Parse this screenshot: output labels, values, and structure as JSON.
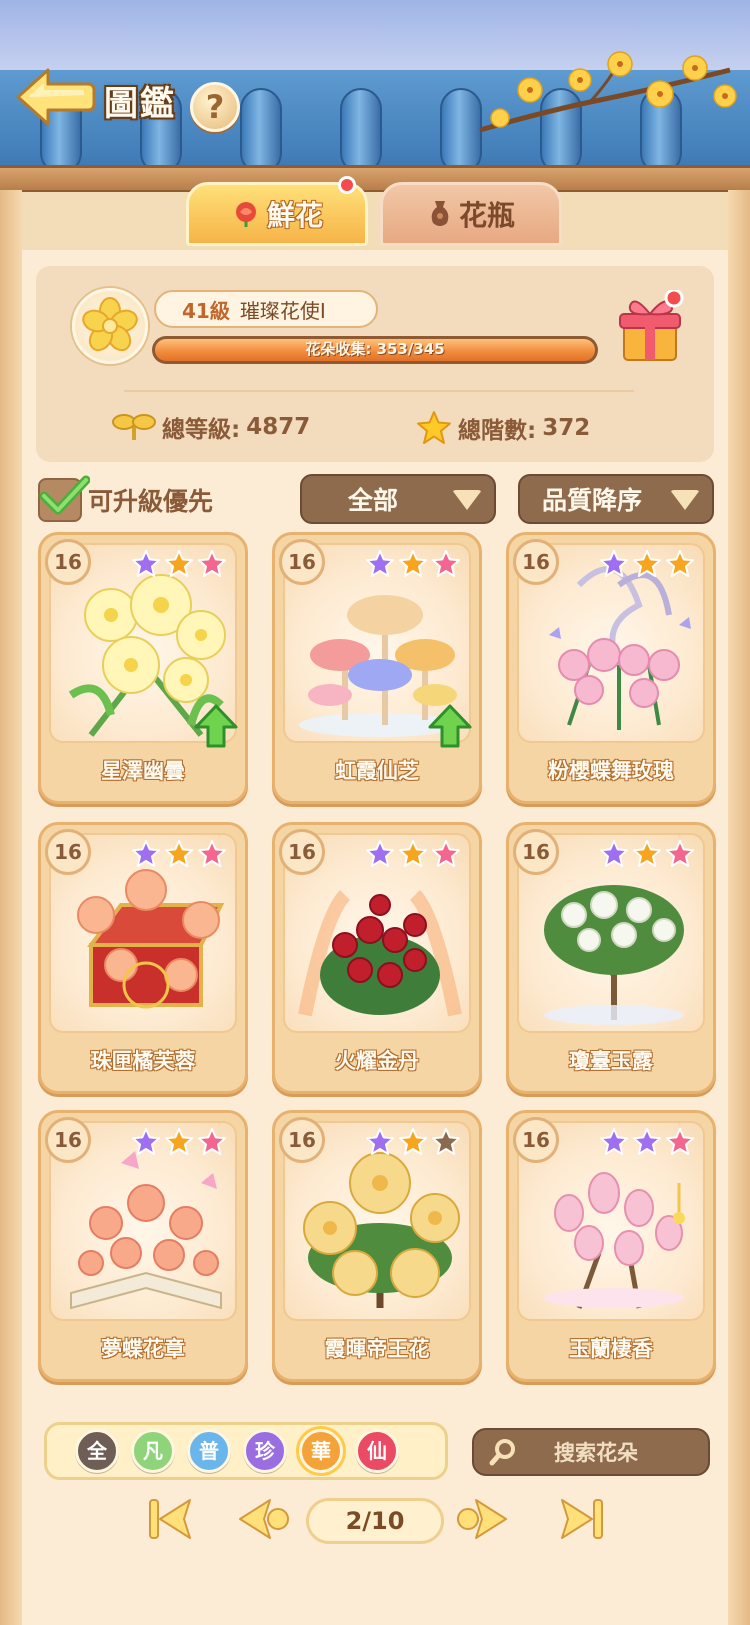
{
  "header": {
    "title": "圖鑑",
    "help_label": "?"
  },
  "tabs": [
    {
      "label": "鮮花",
      "active": true,
      "has_dot": true
    },
    {
      "label": "花瓶",
      "active": false,
      "has_dot": false
    }
  ],
  "summary": {
    "level": "41級",
    "rank_title": "璀璨花使I",
    "collection_label": "花朵收集: 353/345",
    "collection_progress": 1.0,
    "total_level_label": "總等級:",
    "total_level": "4877",
    "total_stars_label": "總階數:",
    "total_stars": "372"
  },
  "filters": {
    "upgrade_first_label": "可升級優先",
    "upgrade_first_checked": true,
    "category": "全部",
    "sort": "品質降序"
  },
  "cards": [
    {
      "level": "16",
      "name": "星澤幽曇",
      "stars": [
        "purple",
        "orange",
        "pink"
      ],
      "upgradable": true,
      "art": "chrysanthemum-yellow"
    },
    {
      "level": "16",
      "name": "虹霞仙芝",
      "stars": [
        "purple",
        "orange",
        "pink"
      ],
      "upgradable": true,
      "art": "mushroom"
    },
    {
      "level": "16",
      "name": "粉櫻蝶舞玫瑰",
      "stars": [
        "purple",
        "orange",
        "orange"
      ],
      "upgradable": false,
      "art": "rose-pink"
    },
    {
      "level": "16",
      "name": "珠匣橘芙蓉",
      "stars": [
        "purple",
        "orange",
        "pink"
      ],
      "upgradable": false,
      "art": "peony-box"
    },
    {
      "level": "16",
      "name": "火耀金丹",
      "stars": [
        "purple",
        "orange",
        "pink"
      ],
      "upgradable": false,
      "art": "camellia-red"
    },
    {
      "level": "16",
      "name": "瓊臺玉露",
      "stars": [
        "purple",
        "orange",
        "pink"
      ],
      "upgradable": false,
      "art": "gardenia-tree"
    },
    {
      "level": "16",
      "name": "夢蝶花章",
      "stars": [
        "purple",
        "orange",
        "pink"
      ],
      "upgradable": false,
      "art": "rose-book"
    },
    {
      "level": "16",
      "name": "霞暉帝王花",
      "stars": [
        "purple",
        "orange",
        "empty"
      ],
      "upgradable": false,
      "art": "protea-gold"
    },
    {
      "level": "16",
      "name": "玉蘭棲香",
      "stars": [
        "purple",
        "purple",
        "pink"
      ],
      "upgradable": false,
      "art": "magnolia"
    }
  ],
  "quality_filters": [
    {
      "label": "全",
      "color": "#6f5e55"
    },
    {
      "label": "凡",
      "color": "#8fd47a"
    },
    {
      "label": "普",
      "color": "#6ab6ea"
    },
    {
      "label": "珍",
      "color": "#9a6ee0"
    },
    {
      "label": "華",
      "color": "#f4a23a"
    },
    {
      "label": "仙",
      "color": "#ea4a63"
    }
  ],
  "search": {
    "placeholder": "搜索花朵"
  },
  "pagination": {
    "current": "2/10"
  },
  "colors": {
    "star_purple": "#a06ef0",
    "star_orange": "#f7a51e",
    "star_pink": "#f2668f",
    "star_empty": "#8c6a4d",
    "accent_orange": "#f08a3b"
  }
}
